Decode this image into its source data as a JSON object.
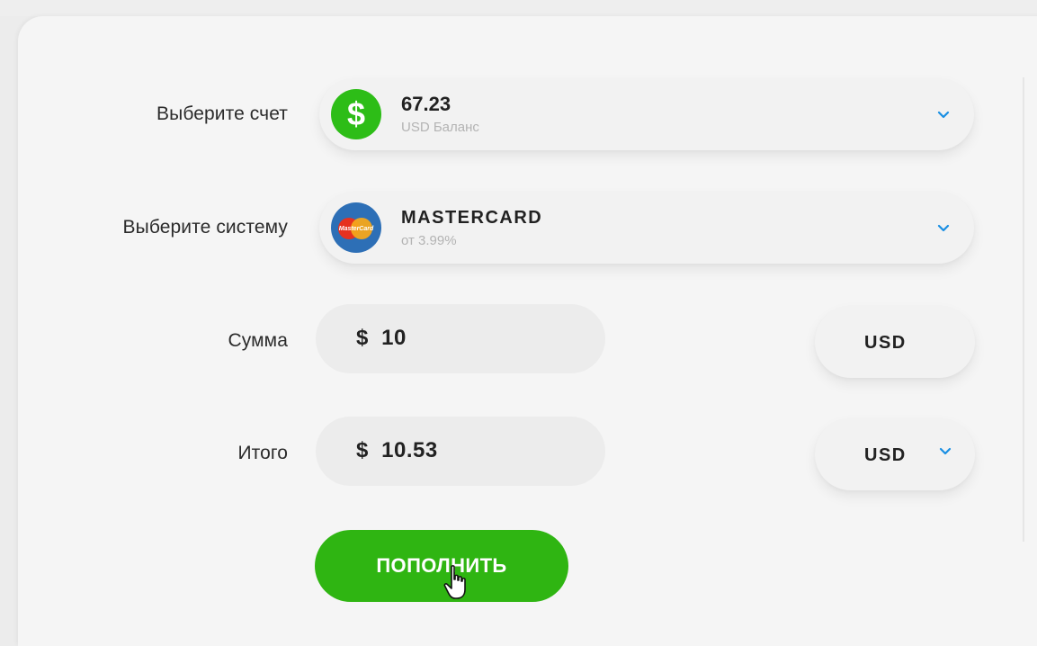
{
  "form": {
    "account": {
      "label": "Выберите счет",
      "value": "67.23",
      "sub": "USD Баланс",
      "icon": "dollar-icon",
      "icon_glyph": "$",
      "icon_color": "#2dbd17"
    },
    "system": {
      "label": "Выберите систему",
      "value": "MASTERCARD",
      "sub": "от 3.99%",
      "icon": "mastercard-icon",
      "icon_text": "MasterCard"
    },
    "amount": {
      "label": "Сумма",
      "value": "$  10",
      "currency": "USD"
    },
    "total": {
      "label": "Итого",
      "value": "$  10.53",
      "currency": "USD"
    },
    "submit_label": "ПОПОЛНИТЬ"
  },
  "colors": {
    "accent_green": "#2fb512",
    "chevron_blue": "#1a8fe3"
  }
}
